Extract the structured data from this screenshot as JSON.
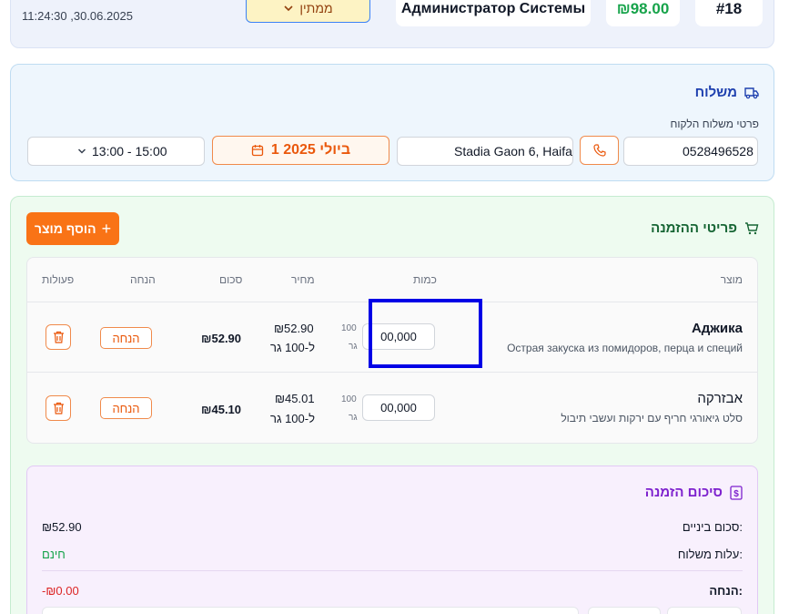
{
  "header": {
    "date": "11:24:30 ,30.06.2025",
    "status": "ממתין",
    "user": "Администратор Системы",
    "total": "₪98.00",
    "order_number": "#18"
  },
  "delivery": {
    "title": "משלוח",
    "subtitle": "פרטי משלוח הלקוח",
    "phone": "0528496528",
    "address": "Stadia Gaon 6, Haifa",
    "date": "1 ביולי 2025",
    "time": "13:00 - 15:00"
  },
  "items": {
    "title": "פריטי ההזמנה",
    "add_button": "הוסף מוצר",
    "columns": {
      "product": "מוצר",
      "quantity": "כמות",
      "price": "מחיר",
      "sum": "סכום",
      "discount": "הנחה",
      "actions": "פעולות"
    },
    "rows": [
      {
        "name": "Аджика",
        "desc": "Острая закуска из помидоров, перца и специй",
        "unit_num": "100",
        "unit_label": "גר",
        "qty": "00,000",
        "price": "₪52.90",
        "price_unit": "ל-100 גר",
        "sum": "₪52.90",
        "discount": "הנחה"
      },
      {
        "name": "אבזרקה",
        "desc": "סלט גיאורגי חריף עם ירקות ועשבי תיבול",
        "unit_num": "100",
        "unit_label": "גר",
        "qty": "00,000",
        "price": "₪45.01",
        "price_unit": "ל-100 גר",
        "sum": "₪45.10",
        "discount": "הנחה"
      }
    ]
  },
  "summary": {
    "title": "סיכום הזמנה",
    "subtotal_label": "סכום ביניים:",
    "subtotal": "₪52.90",
    "shipping_label": "עלות משלוח:",
    "shipping": "חינם",
    "discount_label": "הנחה:",
    "discount": "-₪0.00"
  },
  "colors": {
    "accent": "#f97316",
    "highlight": "#0000e6",
    "success": "#16a34a",
    "danger": "#dc2626"
  }
}
